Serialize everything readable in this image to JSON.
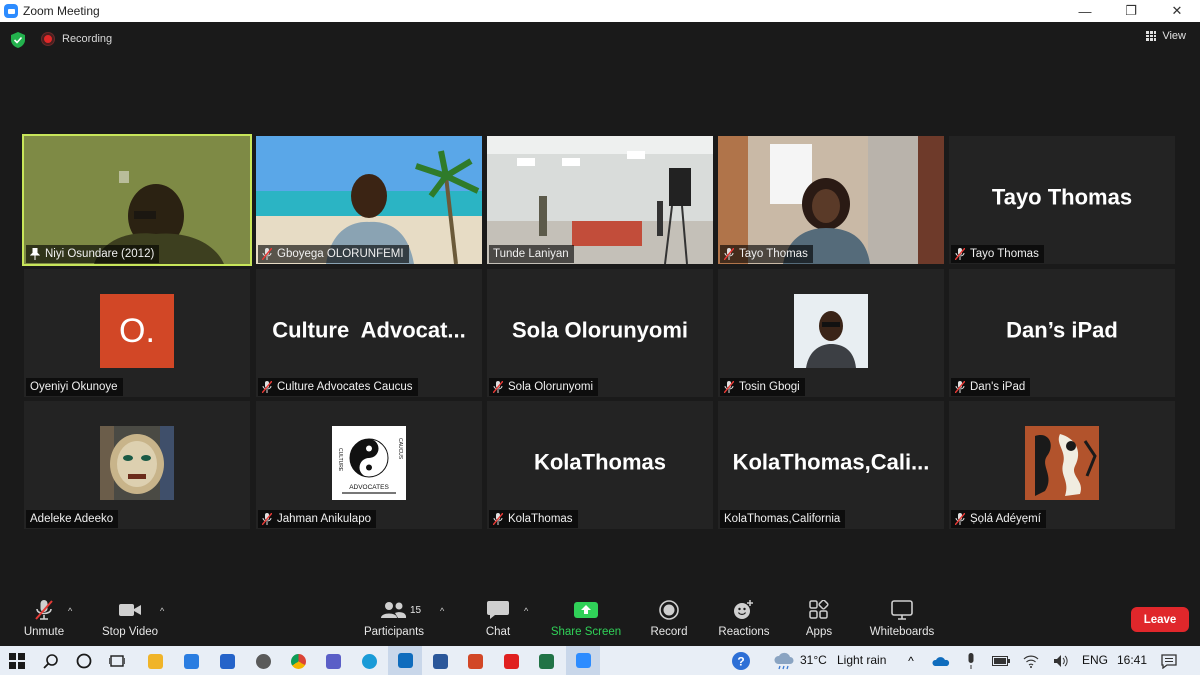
{
  "window": {
    "title": "Zoom Meeting",
    "controls": [
      "—",
      "❐",
      "✕"
    ]
  },
  "topbar": {
    "recording_label": "Recording",
    "view_label": "View"
  },
  "tiles": [
    {
      "name": "Niyi Osundare (2012)",
      "muted": false,
      "pinned": true,
      "type": "video",
      "active": true
    },
    {
      "name": "Gboyega OLORUNFEMI",
      "muted": true,
      "type": "video"
    },
    {
      "name": "Tunde Laniyan",
      "muted": false,
      "type": "video"
    },
    {
      "name": "Tayo Thomas",
      "muted": true,
      "type": "video"
    },
    {
      "name": "Tayo Thomas",
      "big_name": "Tayo Thomas",
      "muted": true,
      "type": "name"
    },
    {
      "name": "Oyeniyi Okunoye",
      "avatar_letter": "O.",
      "muted": false,
      "type": "letter"
    },
    {
      "name": "Culture Advocates Caucus",
      "big_name": "Culture  Advocat...",
      "muted": true,
      "type": "name"
    },
    {
      "name": "Sola Olorunyomi",
      "big_name": "Sola Olorunyomi",
      "muted": true,
      "type": "name"
    },
    {
      "name": "Tosin Gbogi",
      "muted": true,
      "type": "photo"
    },
    {
      "name": "Dan's iPad",
      "big_name": "Dan’s iPad",
      "muted": true,
      "type": "name"
    },
    {
      "name": "Adeleke Adeeko",
      "muted": false,
      "type": "photo"
    },
    {
      "name": "Jahman Anikulapo",
      "muted": true,
      "type": "logo",
      "logo_text": {
        "left": "CULTURE",
        "right": "CAUCUS",
        "bottom": "ADVOCATES"
      }
    },
    {
      "name": "KolaThomas",
      "big_name": "KolaThomas",
      "muted": true,
      "type": "name"
    },
    {
      "name": "KolaThomas,California",
      "big_name": "KolaThomas,Cali...",
      "muted": false,
      "type": "name"
    },
    {
      "name": "Ṣọlá Adéyẹmí",
      "muted": true,
      "type": "photo"
    }
  ],
  "toolbar": {
    "unmute": "Unmute",
    "stop_video": "Stop Video",
    "participants": "Participants",
    "participant_count": "15",
    "chat": "Chat",
    "share_screen": "Share Screen",
    "record": "Record",
    "reactions": "Reactions",
    "apps": "Apps",
    "whiteboards": "Whiteboards",
    "leave": "Leave"
  },
  "taskbar": {
    "weather": "31°C",
    "weather_desc": "Light rain",
    "language": "ENG",
    "time": "16:41"
  },
  "colors": {
    "active_speaker": "#c8e65a",
    "leave": "#e0272b",
    "share": "#30d158",
    "recording": "#e02828"
  }
}
